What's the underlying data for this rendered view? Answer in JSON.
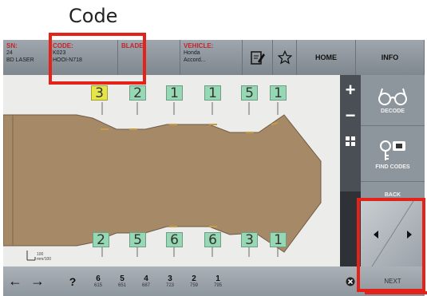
{
  "annotation": {
    "caption": "Code"
  },
  "topbar": {
    "sn": {
      "label": "SN:",
      "lines": [
        "24",
        "BD LASER"
      ]
    },
    "code": {
      "label": "CODE:",
      "lines": [
        "K023",
        "HOOI-N718"
      ]
    },
    "blade": {
      "label": "BLADE:"
    },
    "vehicle": {
      "label": "VEHICLE:",
      "lines": [
        "Honda",
        "Accord..."
      ]
    },
    "buttons": {
      "edit_icon": "edit-note-icon",
      "star_icon": "star-icon",
      "home": "HOME",
      "info": "INFO"
    }
  },
  "key": {
    "top_cuts": [
      "3",
      "2",
      "1",
      "1",
      "5",
      "1"
    ],
    "bottom_cuts": [
      "2",
      "5",
      "6",
      "6",
      "3",
      "1"
    ],
    "selected_top_index": 0,
    "key_color": "#a68a68",
    "scale_label": "100 mm/100"
  },
  "zoom": {
    "plus": "+",
    "minus": "−",
    "fit": "fit-icon"
  },
  "right_panel": {
    "decode": "DECODE",
    "find_codes": "FIND CODES",
    "back": "BACK",
    "next": "NEXT"
  },
  "bottombar": {
    "left_arrow": "←",
    "right_arrow": "→",
    "question": "?",
    "depths": [
      {
        "depth": "6",
        "sub": "615"
      },
      {
        "depth": "5",
        "sub": "651"
      },
      {
        "depth": "4",
        "sub": "687"
      },
      {
        "depth": "3",
        "sub": "723"
      },
      {
        "depth": "2",
        "sub": "759"
      },
      {
        "depth": "1",
        "sub": "795"
      }
    ],
    "clear_icon": "clear-icon"
  },
  "colors": {
    "highlight": "#e32219",
    "selected_cut": "#e4e54c",
    "cut_box": "#96d8b4"
  }
}
